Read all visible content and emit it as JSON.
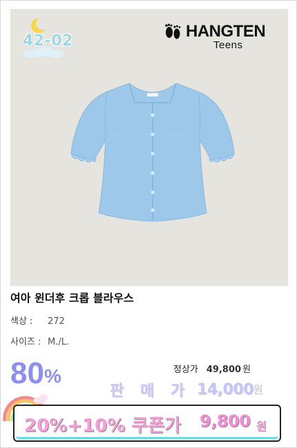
{
  "product_code": "42-02",
  "brand": {
    "name": "HANGTEN",
    "sub": "Teens",
    "logo_icon": "footprints-icon"
  },
  "title": "여아 윈더후 크롭 블라우스",
  "color": {
    "label": "색상 :",
    "value": "272"
  },
  "size": {
    "label": "사이즈 :",
    "value": "M./L."
  },
  "discount": {
    "value": "80",
    "unit": "%"
  },
  "regular_price": {
    "label": "정상가",
    "value": "49,800",
    "currency": "원"
  },
  "sale_price": {
    "label": "판 매 가",
    "value": "14,000",
    "currency": "원"
  },
  "coupon_price": {
    "label": "20%+10% 쿠폰가",
    "value": "9,800",
    "currency": "원"
  },
  "colors": {
    "photo_bg": "#e6e4df",
    "blouse": "#9ec8ea",
    "discount": "#8e8fe8",
    "coupon_text": "#f4a1da",
    "coupon_price": "#f08ed6"
  }
}
